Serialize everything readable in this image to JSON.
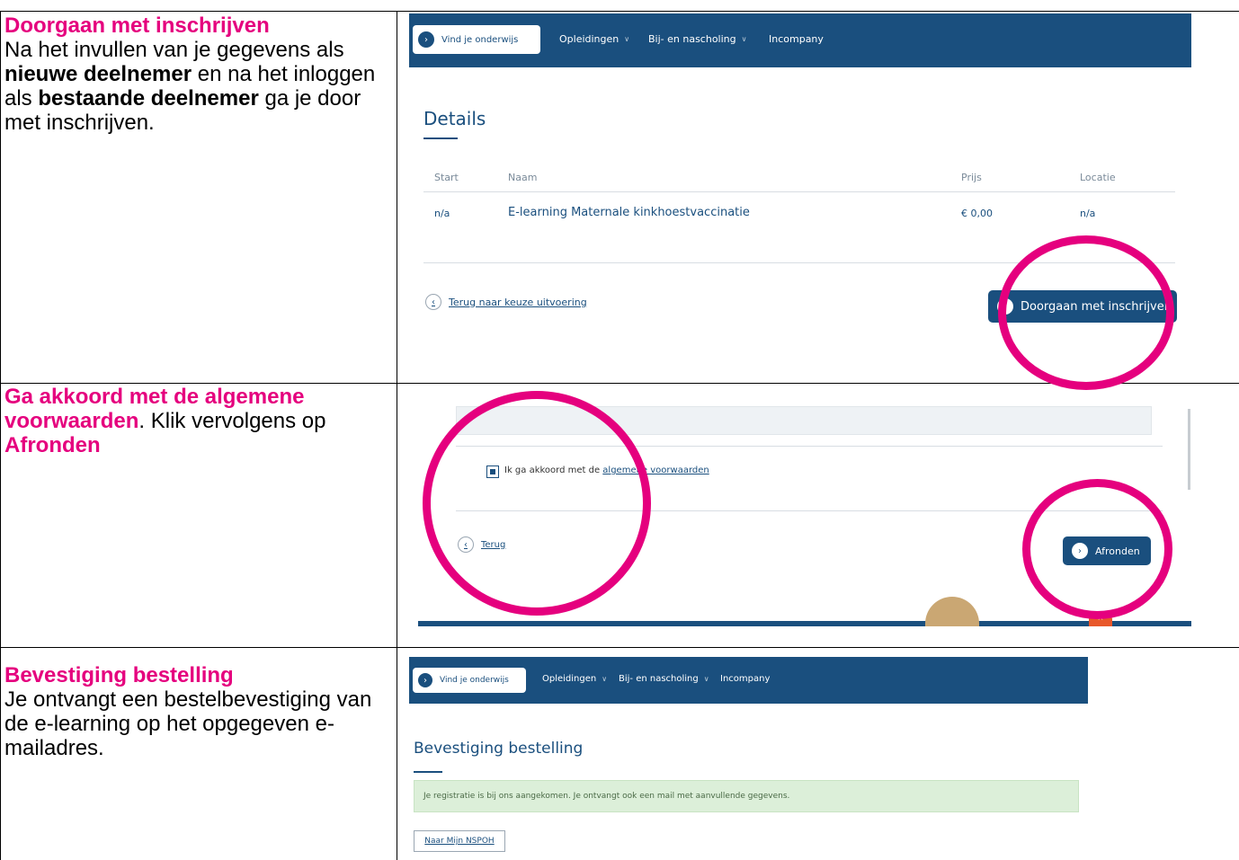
{
  "rows": [
    {
      "heading": "Doorgaan met inschrijven",
      "body_parts": [
        "Na het invullen van je gegevens als ",
        "nieuwe deelnemer",
        " en na het inloggen als ",
        "bestaande deelnemer",
        " ga je door met inschrijven."
      ]
    },
    {
      "heading": "Ga akkoord met de algemene voorwaarden",
      "body_after": ". Klik vervolgens op ",
      "body_end": "Afronden"
    },
    {
      "heading": "Bevestiging bestelling",
      "body": "Je ontvangt een bestelbevestiging van de e-learning op het opgegeven e-mailadres."
    }
  ],
  "nav": {
    "find": "Vind je onderwijs",
    "items": [
      "Opleidingen",
      "Bij- en nascholing",
      "Incompany"
    ]
  },
  "details": {
    "title": "Details",
    "columns": [
      "Start",
      "Naam",
      "Prijs",
      "Locatie"
    ],
    "row": [
      "n/a",
      "E-learning Maternale kinkhoestvaccinatie",
      "€ 0,00",
      "n/a"
    ],
    "back_link": "Terug naar keuze uitvoering",
    "continue_button": "Doorgaan met inschrijven"
  },
  "terms": {
    "agree_prefix": "Ik ga akkoord met de ",
    "agree_link": "algemene voorwaarden",
    "back_link": "Terug",
    "finish_button": "Afronden"
  },
  "confirmation": {
    "title": "Bevestiging bestelling",
    "alert": "Je registratie is bij ons aangekomen. Je ontvangt ook een mail met aanvullende gegevens.",
    "my_button": "Naar Mijn NSPOH"
  },
  "colors": {
    "navy": "#1a4f7e",
    "pink": "#e5007e",
    "alert_green": "#dcefd9"
  },
  "icons": [
    "chevron-right-icon",
    "chevron-left-icon",
    "chevron-down-icon",
    "checkbox-checked-icon",
    "highlight-circle"
  ]
}
